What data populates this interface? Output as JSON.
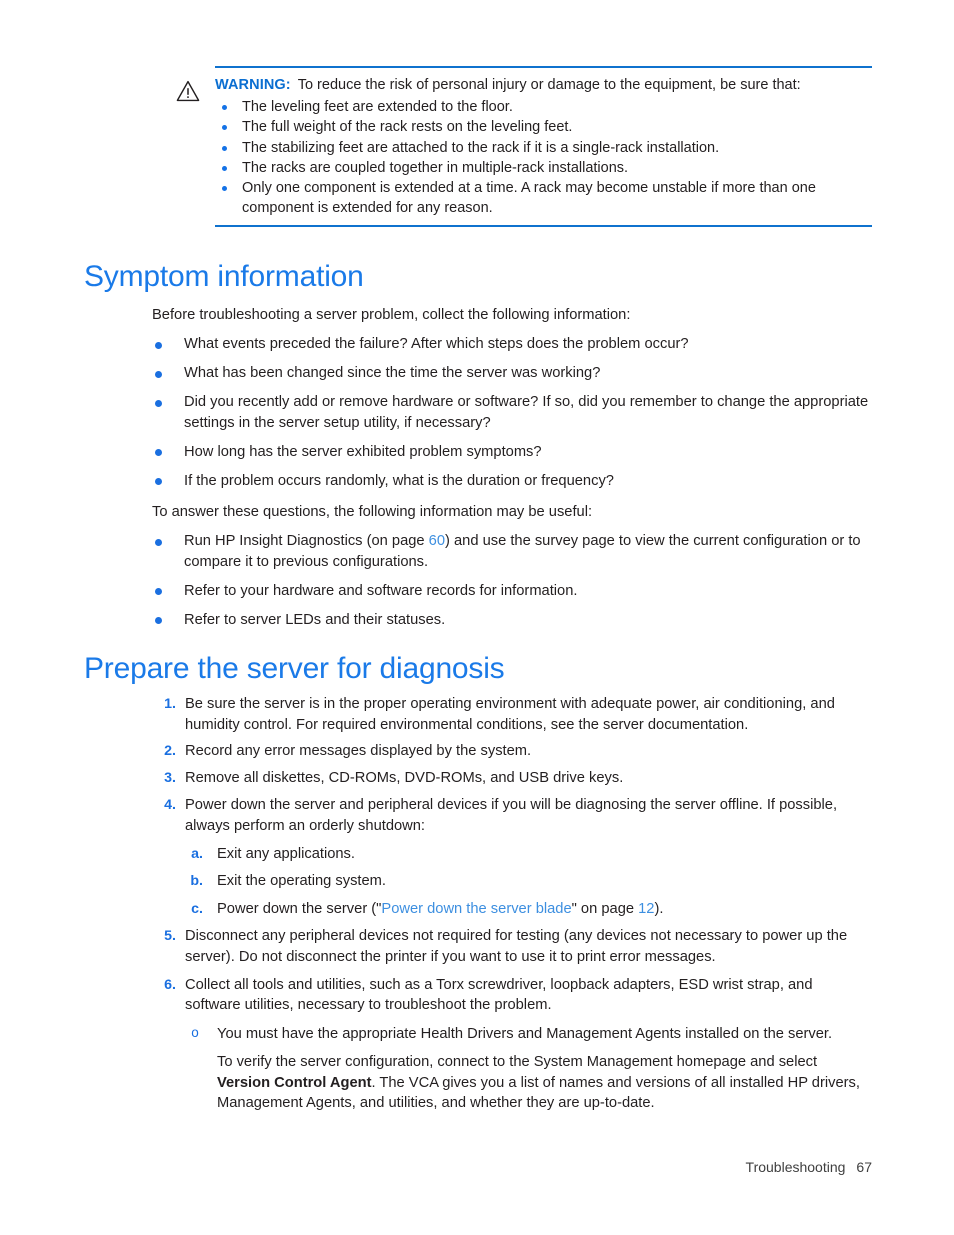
{
  "warning": {
    "icon": "warning-triangle-icon",
    "label": "WARNING:",
    "intro": "To reduce the risk of personal injury or damage to the equipment, be sure that:",
    "items": [
      "The leveling feet are extended to the floor.",
      "The full weight of the rack rests on the leveling feet.",
      "The stabilizing feet are attached to the rack if it is a single-rack installation.",
      "The racks are coupled together in multiple-rack installations.",
      "Only one component is extended at a time. A rack may become unstable if more than one component is extended for any reason."
    ]
  },
  "sections": [
    {
      "heading": "Symptom information",
      "intro": "Before troubleshooting a server problem, collect the following information:",
      "questions": [
        "What events preceded the failure? After which steps does the problem occur?",
        "What has been changed since the time the server was working?",
        "Did you recently add or remove hardware or software? If so, did you remember to change the appropriate settings in the server setup utility, if necessary?",
        "How long has the server exhibited problem symptoms?",
        "If the problem occurs randomly, what is the duration or frequency?"
      ],
      "answer_intro": "To answer these questions, the following information may be useful:",
      "resources": {
        "item1_pre": "Run HP Insight Diagnostics (on page ",
        "item1_page": "60",
        "item1_post": ") and use the survey page to view the current configuration or to compare it to previous configurations.",
        "item2": "Refer to your hardware and software records for information.",
        "item3": "Refer to server LEDs and their statuses."
      }
    },
    {
      "heading": "Prepare the server for diagnosis",
      "steps": [
        {
          "num": "1.",
          "text": "Be sure the server is in the proper operating environment with adequate power, air conditioning, and humidity control. For required environmental conditions, see the server documentation."
        },
        {
          "num": "2.",
          "text": "Record any error messages displayed by the system."
        },
        {
          "num": "3.",
          "text": "Remove all diskettes, CD-ROMs, DVD-ROMs, and USB drive keys."
        },
        {
          "num": "4.",
          "text": "Power down the server and peripheral devices if you will be diagnosing the server offline. If possible, always perform an orderly shutdown:"
        },
        {
          "num": "5.",
          "text": "Disconnect any peripheral devices not required for testing (any devices not necessary to power up the server). Do not disconnect the printer if you want to use it to print error messages."
        },
        {
          "num": "6.",
          "text": "Collect all tools and utilities, such as a Torx screwdriver, loopback adapters, ESD wrist strap, and software utilities, necessary to troubleshoot the problem."
        }
      ],
      "substeps": [
        {
          "letter": "a.",
          "text": "Exit any applications."
        },
        {
          "letter": "b.",
          "text": "Exit the operating system."
        }
      ],
      "substep_c": {
        "letter": "c.",
        "pre": "Power down the server (\"",
        "link": "Power down the server blade",
        "mid": "\" on page ",
        "page": "12",
        "post": ")."
      },
      "note": {
        "marker": "o",
        "text": "You must have the appropriate Health Drivers and Management Agents installed on the server.",
        "detail_pre": "To verify the server configuration, connect to the System Management homepage and select ",
        "detail_bold": "Version Control Agent",
        "detail_post": ". The VCA gives you a list of names and versions of all installed HP drivers, Management Agents, and utilities, and whether they are up-to-date."
      }
    }
  ],
  "footer": {
    "chapter": "Troubleshooting",
    "page": "67"
  },
  "colors": {
    "heading_blue": "#1a7ae8",
    "marker_blue": "#1a6fe0",
    "link_blue": "#3d8fe0",
    "rule_blue": "#0f72ce",
    "body_text": "#231f20"
  }
}
